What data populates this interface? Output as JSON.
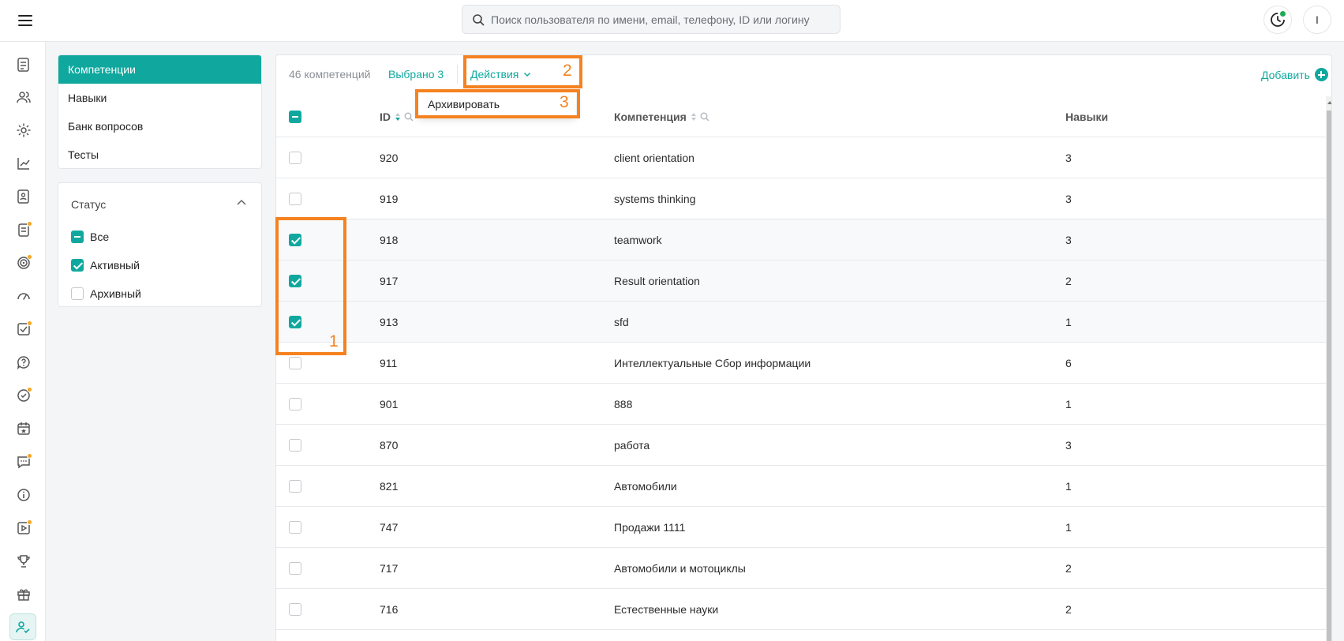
{
  "search": {
    "placeholder": "Поиск пользователя по имени, email, телефону, ID или логину"
  },
  "user": {
    "initial": "I"
  },
  "nav": {
    "items": [
      {
        "label": "Компетенции",
        "active": true
      },
      {
        "label": "Навыки",
        "active": false
      },
      {
        "label": "Банк вопросов",
        "active": false
      },
      {
        "label": "Тесты",
        "active": false
      }
    ]
  },
  "filters": {
    "title": "Статус",
    "options": [
      {
        "label": "Все",
        "state": "mixed"
      },
      {
        "label": "Активный",
        "state": "checked"
      },
      {
        "label": "Архивный",
        "state": "unchecked"
      }
    ]
  },
  "toolbar": {
    "count": "46 компетенций",
    "selected": "Выбрано 3",
    "actions_label": "Действия",
    "add_label": "Добавить"
  },
  "actions_menu": {
    "items": [
      "Архивировать"
    ]
  },
  "table": {
    "columns": {
      "id": "ID",
      "competency": "Компетенция",
      "skills": "Навыки"
    },
    "rows": [
      {
        "id": "920",
        "name": "client orientation",
        "skills": "3",
        "selected": false
      },
      {
        "id": "919",
        "name": "systems thinking",
        "skills": "3",
        "selected": false
      },
      {
        "id": "918",
        "name": "teamwork",
        "skills": "3",
        "selected": true
      },
      {
        "id": "917",
        "name": "Result orientation",
        "skills": "2",
        "selected": true
      },
      {
        "id": "913",
        "name": "sfd",
        "skills": "1",
        "selected": true
      },
      {
        "id": "911",
        "name": "Интеллектуальные Сбор информации",
        "skills": "6",
        "selected": false
      },
      {
        "id": "901",
        "name": "888",
        "skills": "1",
        "selected": false
      },
      {
        "id": "870",
        "name": "работа",
        "skills": "3",
        "selected": false
      },
      {
        "id": "821",
        "name": "Автомобили",
        "skills": "1",
        "selected": false
      },
      {
        "id": "747",
        "name": "Продажи 1111",
        "skills": "1",
        "selected": false
      },
      {
        "id": "717",
        "name": "Автомобили и мотоциклы",
        "skills": "2",
        "selected": false
      },
      {
        "id": "716",
        "name": "Естественные науки",
        "skills": "2",
        "selected": false
      }
    ]
  },
  "rail": {
    "icons": [
      {
        "name": "document-icon",
        "badge": false
      },
      {
        "name": "users-icon",
        "badge": false
      },
      {
        "name": "gear-icon",
        "badge": false
      },
      {
        "name": "chart-icon",
        "badge": false
      },
      {
        "name": "document-user-icon",
        "badge": false
      },
      {
        "name": "clipboard-icon",
        "badge": true
      },
      {
        "name": "target-icon",
        "badge": true
      },
      {
        "name": "gauge-icon",
        "badge": false
      },
      {
        "name": "checklist-icon",
        "badge": true
      },
      {
        "name": "help-icon",
        "badge": false
      },
      {
        "name": "check-circle-icon",
        "badge": true
      },
      {
        "name": "calendar-star-icon",
        "badge": false
      },
      {
        "name": "chat-icon",
        "badge": true
      },
      {
        "name": "info-icon",
        "badge": false
      },
      {
        "name": "play-icon",
        "badge": true
      },
      {
        "name": "trophy-icon",
        "badge": false
      },
      {
        "name": "gift-icon",
        "badge": false
      },
      {
        "name": "user-check-icon",
        "badge": false
      }
    ]
  },
  "annotations": [
    "1",
    "2",
    "3"
  ],
  "colors": {
    "accent": "#10a89e",
    "annotation": "#f58220",
    "badge": "#f5a623",
    "online": "#1faa55"
  }
}
